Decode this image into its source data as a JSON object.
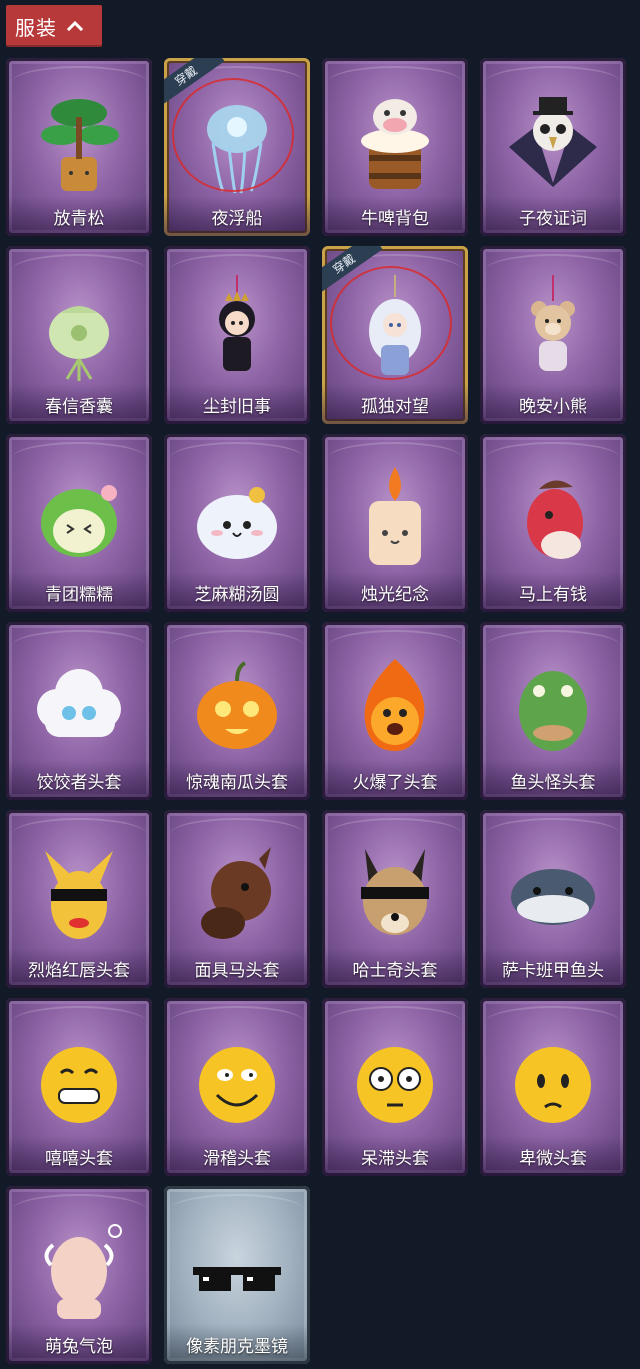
{
  "header": {
    "title": "服装"
  },
  "badge_text": "穿戴",
  "items": [
    {
      "name": "放青松",
      "icon": "bonsai-pine-icon",
      "worn": false
    },
    {
      "name": "夜浮船",
      "icon": "jellyfish-icon",
      "worn": true
    },
    {
      "name": "牛啤背包",
      "icon": "cow-beer-backpack-icon",
      "worn": false
    },
    {
      "name": "子夜证词",
      "icon": "owl-plague-doctor-icon",
      "worn": false
    },
    {
      "name": "春信香囊",
      "icon": "sachet-icon",
      "worn": false
    },
    {
      "name": "尘封旧事",
      "icon": "chibi-figure-charm-icon",
      "worn": false
    },
    {
      "name": "孤独对望",
      "icon": "white-hair-figure-charm-icon",
      "worn": true
    },
    {
      "name": "晚安小熊",
      "icon": "teddy-bear-charm-icon",
      "worn": false
    },
    {
      "name": "青团糯糯",
      "icon": "green-rice-ball-icon",
      "worn": false
    },
    {
      "name": "芝麻糊汤圆",
      "icon": "white-dumpling-icon",
      "worn": false
    },
    {
      "name": "烛光纪念",
      "icon": "candle-icon",
      "worn": false
    },
    {
      "name": "马上有钱",
      "icon": "red-horse-icon",
      "worn": false
    },
    {
      "name": "饺饺者头套",
      "icon": "cloud-mask-icon",
      "worn": false
    },
    {
      "name": "惊魂南瓜头套",
      "icon": "pumpkin-mask-icon",
      "worn": false
    },
    {
      "name": "火爆了头套",
      "icon": "fire-mask-icon",
      "worn": false
    },
    {
      "name": "鱼头怪头套",
      "icon": "fish-head-mask-icon",
      "worn": false
    },
    {
      "name": "烈焰红唇头套",
      "icon": "yellow-pikachu-mask-icon",
      "worn": false
    },
    {
      "name": "面具马头套",
      "icon": "horse-mask-icon",
      "worn": false
    },
    {
      "name": "哈士奇头套",
      "icon": "husky-mask-icon",
      "worn": false
    },
    {
      "name": "萨卡班甲鱼头",
      "icon": "sacabambaspis-mask-icon",
      "worn": false
    },
    {
      "name": "嘻嘻头套",
      "icon": "grin-emoji-mask-icon",
      "worn": false
    },
    {
      "name": "滑稽头套",
      "icon": "funny-emoji-mask-icon",
      "worn": false
    },
    {
      "name": "呆滞头套",
      "icon": "stare-emoji-mask-icon",
      "worn": false
    },
    {
      "name": "卑微头套",
      "icon": "shy-emoji-mask-icon",
      "worn": false
    },
    {
      "name": "萌兔气泡",
      "icon": "bunny-bubble-icon",
      "worn": false
    },
    {
      "name": "像素朋克墨镜",
      "icon": "pixel-sunglasses-icon",
      "worn": false
    }
  ]
}
